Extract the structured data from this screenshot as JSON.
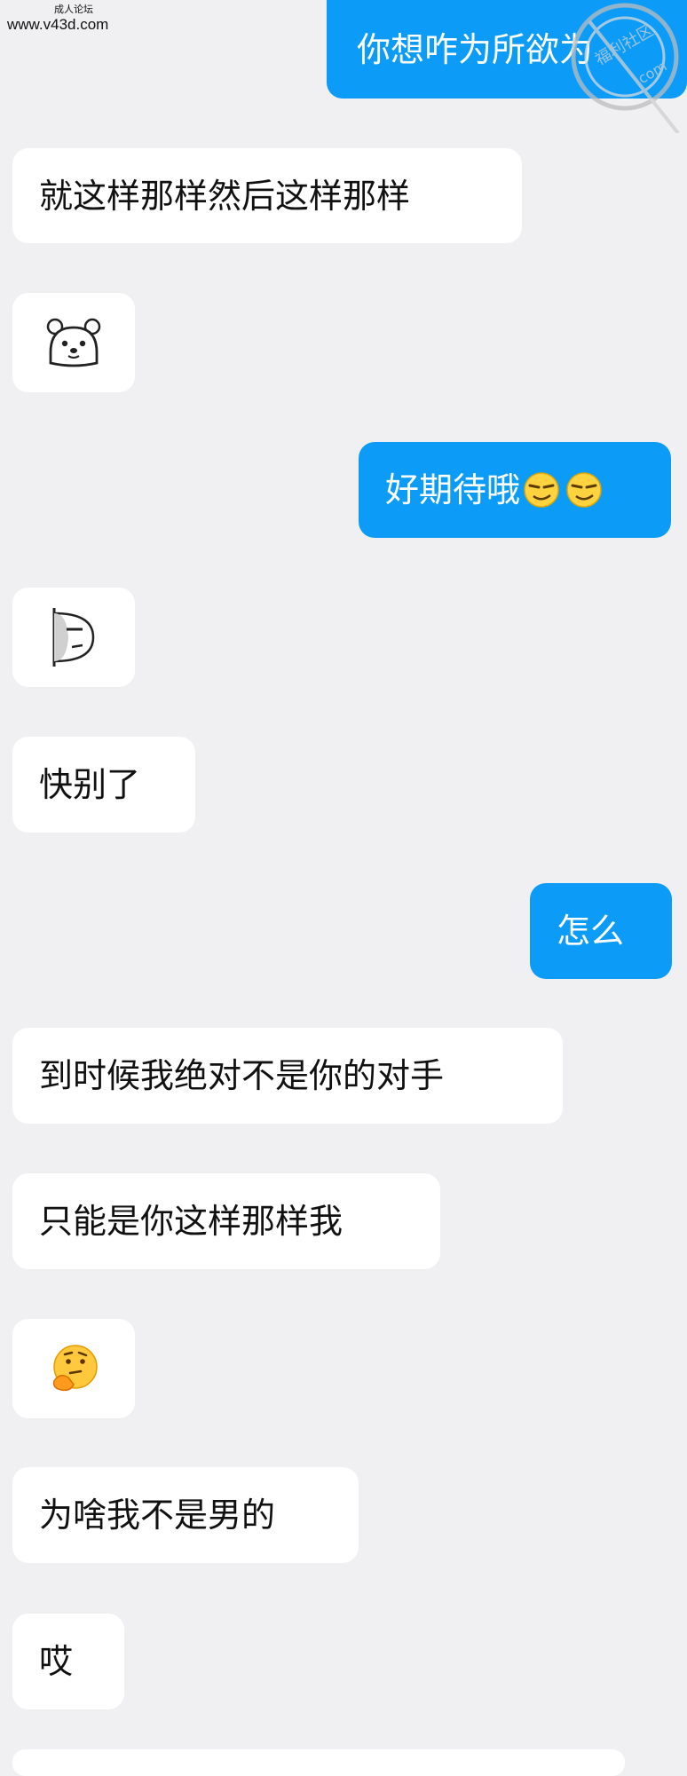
{
  "watermark": {
    "site_name": "成人论坛",
    "url": "www.v43d.com"
  },
  "stamp": {
    "text": "福利社区",
    "domain": ".com"
  },
  "messages": [
    {
      "side": "me",
      "text": "你想咋为所欲为"
    },
    {
      "side": "them",
      "text": "就这样那样然后这样那样"
    },
    {
      "side": "them",
      "emoji": "bear-face-sticker"
    },
    {
      "side": "me",
      "text": "好期待哦",
      "emoji": "smirk-face-emoji ×2"
    },
    {
      "side": "them",
      "emoji": "half-face-peek-sticker"
    },
    {
      "side": "them",
      "text": "快别了"
    },
    {
      "side": "me",
      "text": "怎么"
    },
    {
      "side": "them",
      "text": "到时候我绝对不是你的对手"
    },
    {
      "side": "them",
      "text": "只能是你这样那样我"
    },
    {
      "side": "them",
      "emoji": "thinking-face-emoji"
    },
    {
      "side": "them",
      "text": "为啥我不是男的"
    },
    {
      "side": "them",
      "text": "哎"
    }
  ],
  "colors": {
    "background": "#f0f0f2",
    "me_bubble": "#0c9cf8",
    "them_bubble": "#ffffff"
  }
}
